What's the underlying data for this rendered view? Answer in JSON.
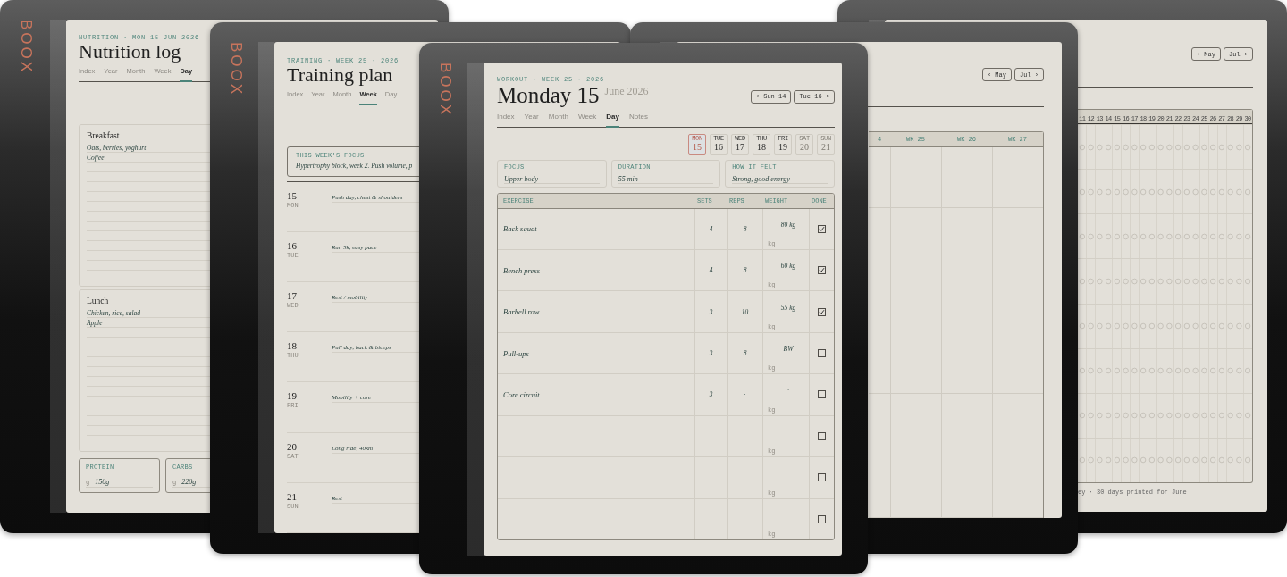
{
  "nutrition_log": {
    "brand": "BOOX",
    "eyebrow": "NUTRITION · MON 15 JUN 2026",
    "title": "Nutrition log",
    "tabs": [
      {
        "label": "Index",
        "selected": false
      },
      {
        "label": "Year",
        "selected": false
      },
      {
        "label": "Month",
        "selected": false
      },
      {
        "label": "Week",
        "selected": false
      },
      {
        "label": "Day",
        "selected": true
      }
    ],
    "meals": [
      {
        "name": "Breakfast",
        "entries": [
          "Oats, berries, yoghurt",
          "Coffee"
        ]
      },
      {
        "name": "Lunch",
        "entries": [
          "Chicken, rice, salad",
          "Apple"
        ]
      }
    ],
    "macros": [
      {
        "label": "PROTEIN",
        "unit": "g",
        "value": "150g"
      },
      {
        "label": "CARBS",
        "unit": "g",
        "value": "220g"
      }
    ]
  },
  "training_plan": {
    "brand": "BOOX",
    "eyebrow": "TRAINING · WEEK 25 · 2026",
    "title": "Training plan",
    "tabs": [
      {
        "label": "Index",
        "selected": false
      },
      {
        "label": "Year",
        "selected": false
      },
      {
        "label": "Month",
        "selected": false
      },
      {
        "label": "Week",
        "selected": true
      },
      {
        "label": "Day",
        "selected": false
      }
    ],
    "focus": {
      "label": "THIS WEEK'S FOCUS",
      "text": "Hypertrophy block, week 2. Push volume, p"
    },
    "days": [
      {
        "day": "15",
        "weekday": "MON",
        "plan": "Push day, chest & shoulders"
      },
      {
        "day": "16",
        "weekday": "TUE",
        "plan": "Run 5k, easy pace"
      },
      {
        "day": "17",
        "weekday": "WED",
        "plan": "Rest / mobility"
      },
      {
        "day": "18",
        "weekday": "THU",
        "plan": "Pull day, back & biceps"
      },
      {
        "day": "19",
        "weekday": "FRI",
        "plan": "Mobility + core"
      },
      {
        "day": "20",
        "weekday": "SAT",
        "plan": "Long ride, 40km"
      },
      {
        "day": "21",
        "weekday": "SUN",
        "plan": "Rest"
      }
    ]
  },
  "workout_day": {
    "brand": "BOOX",
    "eyebrow": "WORKOUT · WEEK 25 · 2026",
    "title": "Monday 15",
    "subtitle": "June 2026",
    "nav": [
      "‹ Sun 14",
      "Tue 16 ›"
    ],
    "tabs": [
      {
        "label": "Index",
        "selected": false
      },
      {
        "label": "Year",
        "selected": false
      },
      {
        "label": "Month",
        "selected": false
      },
      {
        "label": "Week",
        "selected": false
      },
      {
        "label": "Day",
        "selected": true
      },
      {
        "label": "Notes",
        "selected": false
      }
    ],
    "days": [
      {
        "weekday": "MON",
        "day": "15",
        "selected": true,
        "weekend": false
      },
      {
        "weekday": "TUE",
        "day": "16",
        "selected": false,
        "weekend": false
      },
      {
        "weekday": "WED",
        "day": "17",
        "selected": false,
        "weekend": false
      },
      {
        "weekday": "THU",
        "day": "18",
        "selected": false,
        "weekend": false
      },
      {
        "weekday": "FRI",
        "day": "19",
        "selected": false,
        "weekend": false
      },
      {
        "weekday": "SAT",
        "day": "20",
        "selected": false,
        "weekend": true
      },
      {
        "weekday": "SUN",
        "day": "21",
        "selected": false,
        "weekend": true
      }
    ],
    "fields": [
      {
        "label": "FOCUS",
        "value": "Upper body"
      },
      {
        "label": "DURATION",
        "value": "55 min"
      },
      {
        "label": "HOW IT FELT",
        "value": "Strong, good energy"
      }
    ],
    "columns": [
      "EXERCISE",
      "SETS",
      "REPS",
      "WEIGHT",
      "DONE"
    ],
    "exercises": [
      {
        "exercise": "Back squat",
        "sets": "4",
        "reps": "8",
        "weight": "80 kg",
        "unit": "kg",
        "done": true
      },
      {
        "exercise": "Bench press",
        "sets": "4",
        "reps": "8",
        "weight": "60 kg",
        "unit": "kg",
        "done": true
      },
      {
        "exercise": "Barbell row",
        "sets": "3",
        "reps": "10",
        "weight": "55 kg",
        "unit": "kg",
        "done": true
      },
      {
        "exercise": "Pull-ups",
        "sets": "3",
        "reps": "8",
        "weight": "BW",
        "unit": "kg",
        "done": false
      },
      {
        "exercise": "Core circuit",
        "sets": "3",
        "reps": "·",
        "weight": "·",
        "unit": "kg",
        "done": false
      },
      {
        "unit": "kg",
        "done": false
      },
      {
        "unit": "kg",
        "done": false
      },
      {
        "unit": "kg",
        "done": false
      }
    ]
  },
  "week_columns_page": {
    "nav": [
      "‹ May",
      "Jul ›"
    ],
    "columns": [
      "4",
      "WK 25",
      "WK 26",
      "WK 27"
    ]
  },
  "habit_tracker_page": {
    "nav": [
      "‹ May",
      "Jul ›"
    ],
    "days": [
      "11",
      "12",
      "13",
      "14",
      "15",
      "16",
      "17",
      "18",
      "19",
      "20",
      "21",
      "22",
      "23",
      "24",
      "25",
      "26",
      "27",
      "28",
      "29",
      "30"
    ],
    "footer": "ey · 30 days printed for June"
  }
}
